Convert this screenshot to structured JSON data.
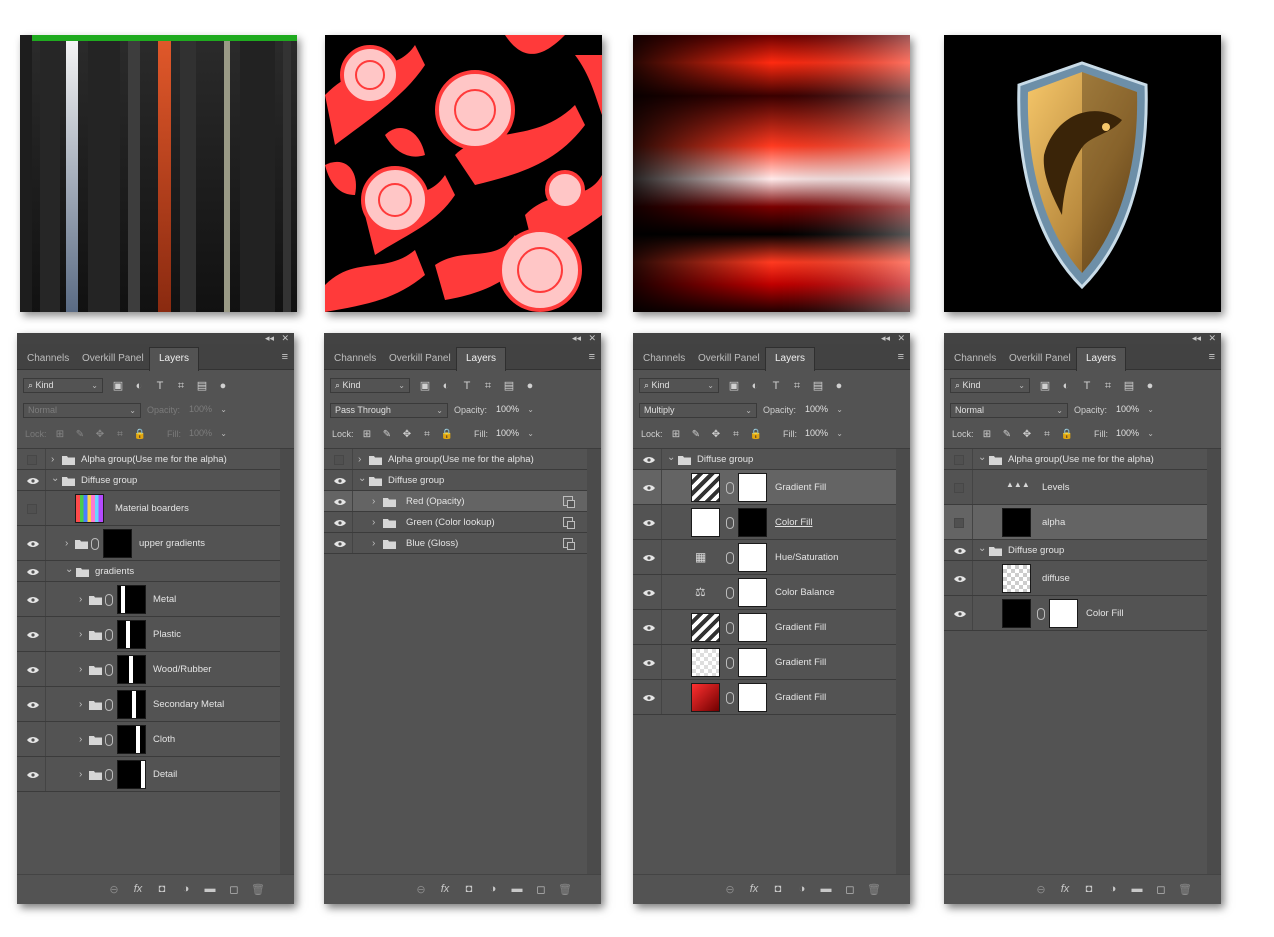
{
  "tabs": {
    "channels": "Channels",
    "overkill": "Overkill Panel",
    "layers": "Layers"
  },
  "filter": {
    "kind": "Kind"
  },
  "labels": {
    "opacity": "Opacity:",
    "lock": "Lock:",
    "fill": "Fill:"
  },
  "icons": {
    "filter": "search-icon",
    "image": "image-filter-icon",
    "adjustment": "adjustment-filter-icon",
    "type": "type-filter-icon",
    "shape": "shape-filter-icon",
    "smart": "smart-object-filter-icon",
    "toggle": "filter-toggle-icon",
    "eye": "eye-icon",
    "folder": "folder-icon",
    "link": "link-icon",
    "chevron": "chevron-right-icon",
    "footer": [
      "link-layers-icon",
      "fx-icon",
      "add-mask-icon",
      "new-adjustment-icon",
      "new-group-icon",
      "new-layer-icon",
      "trash-icon"
    ]
  },
  "panels": [
    {
      "blend": "Normal",
      "opacity": "100%",
      "fill": "100%",
      "disabled": true,
      "layers": [
        {
          "name": "Alpha group(Use me for the alpha)",
          "type": "group",
          "visible": false,
          "expanded": false,
          "indent": 0
        },
        {
          "name": "Diffuse group",
          "type": "group",
          "visible": true,
          "expanded": true,
          "indent": 0
        },
        {
          "name": "Material boarders",
          "type": "image-rainbow",
          "visible": false,
          "indent": 1
        },
        {
          "name": "upper gradients",
          "type": "group-mask",
          "visible": true,
          "expanded": false,
          "indent": 1
        },
        {
          "name": "gradients",
          "type": "group",
          "visible": true,
          "expanded": true,
          "indent": 1
        },
        {
          "name": "Metal",
          "type": "group-mask",
          "visible": true,
          "indent": 2,
          "stripe": 0.1
        },
        {
          "name": "Plastic",
          "type": "group-mask",
          "visible": true,
          "indent": 2,
          "stripe": 0.3
        },
        {
          "name": "Wood/Rubber",
          "type": "group-mask",
          "visible": true,
          "indent": 2,
          "stripe": 0.45
        },
        {
          "name": "Secondary Metal",
          "type": "group-mask",
          "visible": true,
          "indent": 2,
          "stripe": 0.55
        },
        {
          "name": "Cloth",
          "type": "group-mask",
          "visible": true,
          "indent": 2,
          "stripe": 0.72
        },
        {
          "name": "Detail",
          "type": "group-mask",
          "visible": true,
          "indent": 2,
          "stripe": 0.9
        }
      ]
    },
    {
      "blend": "Pass Through",
      "opacity": "100%",
      "fill": "100%",
      "disabled": false,
      "layers": [
        {
          "name": "Alpha group(Use me for the alpha)",
          "type": "group",
          "visible": false,
          "expanded": false,
          "indent": 0
        },
        {
          "name": "Diffuse group",
          "type": "group",
          "visible": true,
          "expanded": true,
          "indent": 0
        },
        {
          "name": "Red (Opacity)",
          "type": "group-smart",
          "visible": true,
          "indent": 1,
          "selected": true
        },
        {
          "name": "Green (Color lookup)",
          "type": "group-smart",
          "visible": true,
          "indent": 1
        },
        {
          "name": "Blue (Gloss)",
          "type": "group-smart",
          "visible": true,
          "indent": 1
        }
      ]
    },
    {
      "blend": "Multiply",
      "opacity": "100%",
      "fill": "100%",
      "disabled": false,
      "layers": [
        {
          "name": "Diffuse group",
          "type": "group",
          "visible": true,
          "expanded": true,
          "indent": 0
        },
        {
          "name": "Gradient Fill",
          "type": "fill-gradient-bw",
          "visible": true,
          "indent": 1,
          "selected": true
        },
        {
          "name": "Color Fill",
          "type": "fill-black",
          "visible": true,
          "indent": 1,
          "underline": true
        },
        {
          "name": "Hue/Saturation",
          "type": "adj-hue",
          "visible": true,
          "indent": 1
        },
        {
          "name": "Color Balance",
          "type": "adj-balance",
          "visible": true,
          "indent": 1
        },
        {
          "name": "Gradient Fill",
          "type": "fill-gradient-bw",
          "visible": true,
          "indent": 1
        },
        {
          "name": "Gradient Fill",
          "type": "fill-gradient-check",
          "visible": true,
          "indent": 1
        },
        {
          "name": "Gradient Fill",
          "type": "fill-gradient-red",
          "visible": true,
          "indent": 1
        }
      ]
    },
    {
      "blend": "Normal",
      "opacity": "100%",
      "fill": "100%",
      "disabled": false,
      "layers": [
        {
          "name": "Alpha group(Use me for the alpha)",
          "type": "group",
          "visible": false,
          "expanded": true,
          "indent": 0
        },
        {
          "name": "Levels",
          "type": "adj-levels",
          "visible": false,
          "indent": 1
        },
        {
          "name": "alpha",
          "type": "image-alpha",
          "visible": false,
          "indent": 1,
          "selected": true
        },
        {
          "name": "Diffuse group",
          "type": "group",
          "visible": true,
          "expanded": true,
          "indent": 0
        },
        {
          "name": "diffuse",
          "type": "image-diffuse",
          "visible": true,
          "indent": 1
        },
        {
          "name": "Color Fill",
          "type": "fill-black",
          "visible": true,
          "indent": 1
        }
      ]
    }
  ]
}
